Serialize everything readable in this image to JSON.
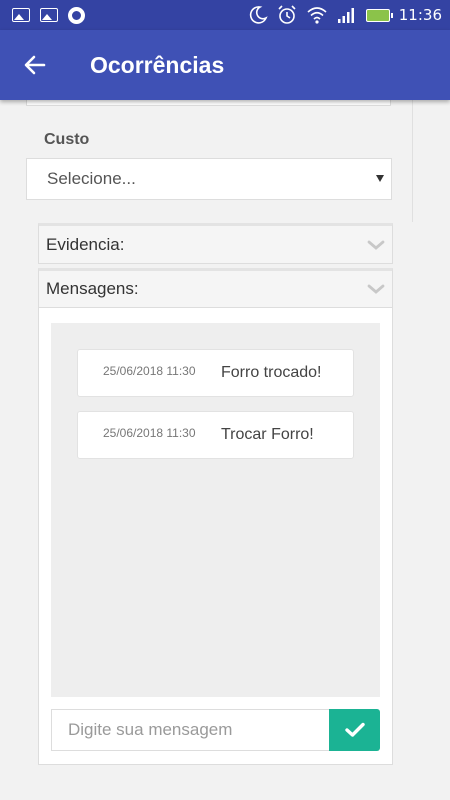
{
  "status_bar": {
    "time": "11:36",
    "icons": [
      "image-icon",
      "image-icon",
      "circle-icon",
      "moon-icon",
      "alarm-icon",
      "wifi-icon",
      "signal-icon",
      "battery-charging-icon"
    ]
  },
  "app_bar": {
    "title": "Ocorrências",
    "back_icon": "arrow-left-icon",
    "color": "#3f51b5"
  },
  "custo": {
    "label": "Custo",
    "select_value": "Selecione..."
  },
  "evidencia_panel": {
    "title": "Evidencia:"
  },
  "mensagens_panel": {
    "title": "Mensagens:",
    "messages": [
      {
        "date": "25/06/2018 11:30",
        "text": "Forro trocado!"
      },
      {
        "date": "25/06/2018 11:30",
        "text": "Trocar Forro!"
      }
    ],
    "input_placeholder": "Digite sua mensagem",
    "send_icon": "check-icon",
    "send_color": "#1bb394"
  }
}
